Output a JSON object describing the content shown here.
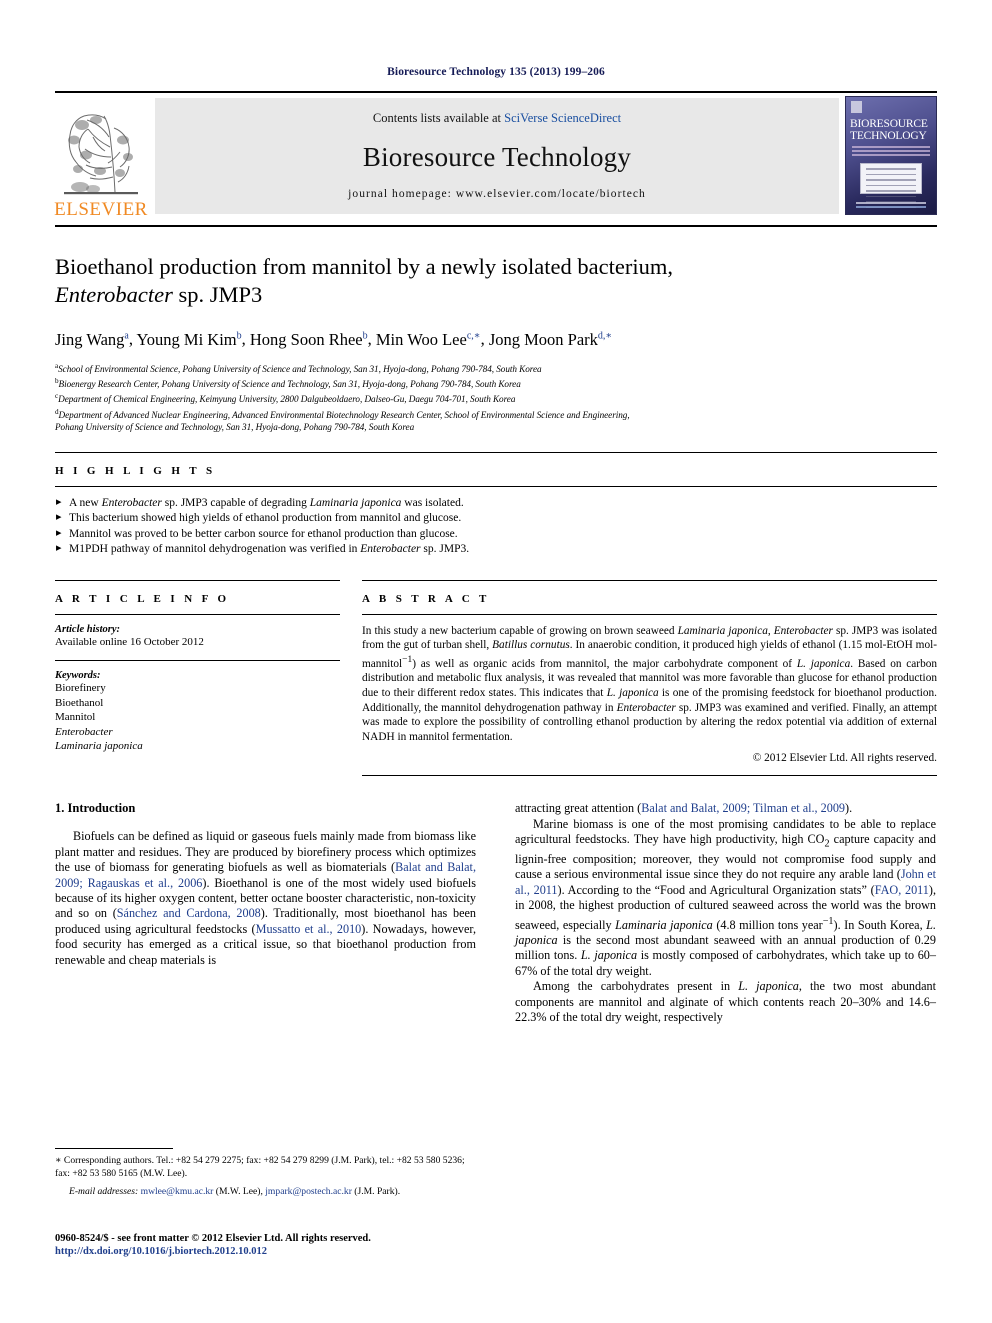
{
  "running_head": "Bioresource Technology 135 (2013) 199–206",
  "masthead": {
    "publisher_name": "ELSEVIER",
    "contents_prefix": "Contents lists available at ",
    "contents_link": "SciVerse ScienceDirect",
    "journal_name": "Bioresource Technology",
    "homepage": "journal homepage: www.elsevier.com/locate/biortech",
    "cover_title_line1": "BIORESOURCE",
    "cover_title_line2": "TECHNOLOGY"
  },
  "article": {
    "title_line1": "Bioethanol production from mannitol by a newly isolated bacterium,",
    "title_line2_italic": "Enterobacter",
    "title_line2_rest": " sp. JMP3",
    "authors": [
      {
        "name": "Jing Wang",
        "marks": "a",
        "sep": ", "
      },
      {
        "name": "Young Mi Kim",
        "marks": "b",
        "sep": ", "
      },
      {
        "name": "Hong Soon Rhee",
        "marks": "b",
        "sep": ", "
      },
      {
        "name": "Min Woo Lee",
        "marks": "c,∗",
        "sep": ", "
      },
      {
        "name": "Jong Moon Park",
        "marks": "d,∗",
        "sep": ""
      }
    ],
    "affiliations": [
      {
        "mark": "a",
        "text": "School of Environmental Science, Pohang University of Science and Technology, San 31, Hyoja-dong, Pohang 790-784, South Korea"
      },
      {
        "mark": "b",
        "text": "Bioenergy Research Center, Pohang University of Science and Technology, San 31, Hyoja-dong, Pohang 790-784, South Korea"
      },
      {
        "mark": "c",
        "text": "Department of Chemical Engineering, Keimyung University, 2800 Dalgubeoldaero, Dalseo-Gu, Daegu 704-701, South Korea"
      },
      {
        "mark": "d",
        "text": "Department of Advanced Nuclear Engineering, Advanced Environmental Biotechnology Research Center, School of Environmental Science and Engineering,"
      },
      {
        "mark": "",
        "text": "Pohang University of Science and Technology, San 31, Hyoja-dong, Pohang 790-784, South Korea"
      }
    ]
  },
  "highlights": {
    "label": "H I G H L I G H T S",
    "items": [
      {
        "pre": "A new ",
        "ital": "Enterobacter",
        "post": " sp. JMP3 capable of degrading ",
        "ital2": "Laminaria japonica",
        "post2": " was isolated."
      },
      {
        "pre": "This bacterium showed high yields of ethanol production from mannitol and glucose.",
        "ital": "",
        "post": "",
        "ital2": "",
        "post2": ""
      },
      {
        "pre": "Mannitol was proved to be better carbon source for ethanol production than glucose.",
        "ital": "",
        "post": "",
        "ital2": "",
        "post2": ""
      },
      {
        "pre": "M1PDH pathway of mannitol dehydrogenation was verified in ",
        "ital": "Enterobacter",
        "post": " sp. JMP3.",
        "ital2": "",
        "post2": ""
      }
    ]
  },
  "article_info": {
    "label": "A R T I C L E    I N F O",
    "history_label": "Article history:",
    "history_value": "Available online 16 October 2012",
    "keywords_label": "Keywords:",
    "keywords": [
      "Biorefinery",
      "Bioethanol",
      "Mannitol",
      "Enterobacter",
      "Laminaria japonica"
    ],
    "keywords_italic_from_index": 3
  },
  "abstract": {
    "label": "A B S T R A C T",
    "copyright": "© 2012 Elsevier Ltd. All rights reserved.",
    "parts": [
      {
        "t": "In this study a new bacterium capable of growing on brown seaweed "
      },
      {
        "t": "Laminaria japonica",
        "i": true
      },
      {
        "t": ", "
      },
      {
        "t": "Enterobacter",
        "i": true
      },
      {
        "t": " sp. JMP3 was isolated from the gut of turban shell, "
      },
      {
        "t": "Batillus cornutus",
        "i": true
      },
      {
        "t": ". In anaerobic condition, it produced high yields of ethanol (1.15 mol-EtOH mol-mannitol"
      },
      {
        "t": "−1",
        "sup": true
      },
      {
        "t": ") as well as organic acids from mannitol, the major carbohydrate component of "
      },
      {
        "t": "L. japonica",
        "i": true
      },
      {
        "t": ". Based on carbon distribution and metabolic flux analysis, it was revealed that mannitol was more favorable than glucose for ethanol production due to their different redox states. This indicates that "
      },
      {
        "t": "L. japonica",
        "i": true
      },
      {
        "t": " is one of the promising feedstock for bioethanol production. Additionally, the mannitol dehydrogenation pathway in "
      },
      {
        "t": "Enterobacter",
        "i": true
      },
      {
        "t": " sp. JMP3 was examined and verified. Finally, an attempt was made to explore the possibility of controlling ethanol production by altering the redox potential via addition of external NADH in mannitol fermentation."
      }
    ]
  },
  "introduction": {
    "heading": "1. Introduction",
    "left_paragraphs": [
      [
        {
          "t": "Biofuels can be defined as liquid or gaseous fuels mainly made from biomass like plant matter and residues. They are produced by biorefinery process which optimizes the use of biomass for generating biofuels as well as biomaterials ("
        },
        {
          "t": "Balat and Balat, 2009; Ragauskas et al., 2006",
          "ref": true
        },
        {
          "t": "). Bioethanol is one of the most widely used biofuels because of its higher oxygen content, better octane booster characteristic, non-toxicity and so on ("
        },
        {
          "t": "Sánchez and Cardona, 2008",
          "ref": true
        },
        {
          "t": "). Traditionally, most bioethanol has been produced using agricultural feedstocks ("
        },
        {
          "t": "Mussatto et al., 2010",
          "ref": true
        },
        {
          "t": "). Nowadays, however, food security has emerged as a critical issue, so that bioethanol production from renewable and cheap materials is"
        }
      ]
    ],
    "right_paragraphs": [
      [
        {
          "t": "attracting great attention ("
        },
        {
          "t": "Balat and Balat, 2009; Tilman et al., 2009",
          "ref": true
        },
        {
          "t": ")."
        }
      ],
      [
        {
          "t": "Marine biomass is one of the most promising candidates to be able to replace agricultural feedstocks. They have high productivity, high CO"
        },
        {
          "t": "2",
          "sub": true
        },
        {
          "t": " capture capacity and lignin-free composition; moreover, they would not compromise food supply and cause a serious environmental issue since they do not require any arable land ("
        },
        {
          "t": "John et al., 2011",
          "ref": true
        },
        {
          "t": "). According to the “Food and Agricultural Organization stats” ("
        },
        {
          "t": "FAO, 2011",
          "ref": true
        },
        {
          "t": "), in 2008, the highest production of cultured seaweed across the world was the brown seaweed, especially "
        },
        {
          "t": "Laminaria japonica",
          "i": true
        },
        {
          "t": " (4.8 million tons year"
        },
        {
          "t": "−1",
          "sup": true
        },
        {
          "t": "). In South Korea, "
        },
        {
          "t": "L. japonica",
          "i": true
        },
        {
          "t": " is the second most abundant seaweed with an annual production of 0.29 million tons. "
        },
        {
          "t": "L. japonica",
          "i": true
        },
        {
          "t": " is mostly composed of carbohydrates, which take up to 60–67% of the total dry weight."
        }
      ],
      [
        {
          "t": "Among the carbohydrates present in "
        },
        {
          "t": "L. japonica",
          "i": true
        },
        {
          "t": ", the two most abundant components are mannitol and alginate of which contents reach 20–30% and 14.6–22.3% of the total dry weight, respectively"
        }
      ]
    ]
  },
  "footnotes": {
    "corresponding": "∗ Corresponding authors. Tel.: +82 54 279 2275; fax: +82 54 279 8299 (J.M. Park), tel.: +82 53 580 5236; fax: +82 53 580 5165 (M.W. Lee).",
    "email_label": "E-mail addresses:",
    "email_1": "mwlee@kmu.ac.kr",
    "email_1_owner": " (M.W. Lee), ",
    "email_2": "jmpark@postech.ac.kr",
    "email_2_owner": " (J.M. Park)."
  },
  "imprint": {
    "line1": "0960-8524/$ - see front matter © 2012 Elsevier Ltd. All rights reserved.",
    "line2": "http://dx.doi.org/10.1016/j.biortech.2012.10.012"
  },
  "colors": {
    "link": "#1f3e8c",
    "running_head": "#151b56",
    "elsevier_orange": "#f08a24",
    "band_gray": "#e8e8e8"
  }
}
